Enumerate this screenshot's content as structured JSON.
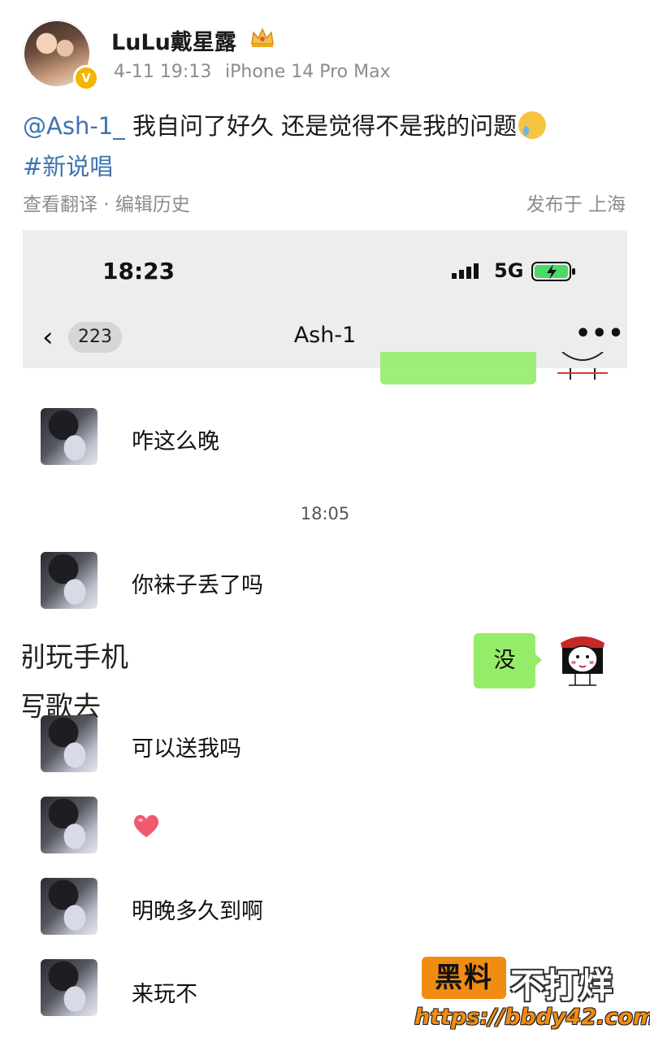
{
  "post": {
    "author": "LuLu戴星露",
    "time": "4-11 19:13",
    "device": "iPhone 14 Pro Max",
    "mention": "@Ash-1_",
    "text": " 我自问了好久 还是觉得不是我的问题",
    "hashtag": "#新说唱",
    "translate_history": "查看翻译 · 编辑历史",
    "location": "发布于 上海",
    "verified_mark": "V"
  },
  "screenshot": {
    "status_time": "18:23",
    "network": "5G",
    "back_count": "223",
    "chat_title": "Ash-1",
    "more": "•••",
    "timestamp": "18:05",
    "messages": {
      "m1": "咋这么晚",
      "m2": "你袜子丢了吗",
      "m3": "可以送我吗",
      "m5": "明晚多久到啊",
      "m6": "来玩不"
    },
    "my_reply": "没",
    "overlay_line1": "别玩手机",
    "overlay_line2": "写歌去"
  },
  "watermark": {
    "box": "黑料",
    "text": "不打烊",
    "url": "https://bbdy42.com"
  },
  "colors": {
    "accent_link": "#3e74b0",
    "wechat_green": "#95ec69",
    "watermark_orange": "#f08c12"
  },
  "icons": [
    "crown-icon",
    "verified-icon",
    "crying-emoji-icon",
    "signal-icon",
    "battery-charging-icon",
    "back-chevron-icon",
    "more-icon",
    "heart-emoji-icon"
  ]
}
